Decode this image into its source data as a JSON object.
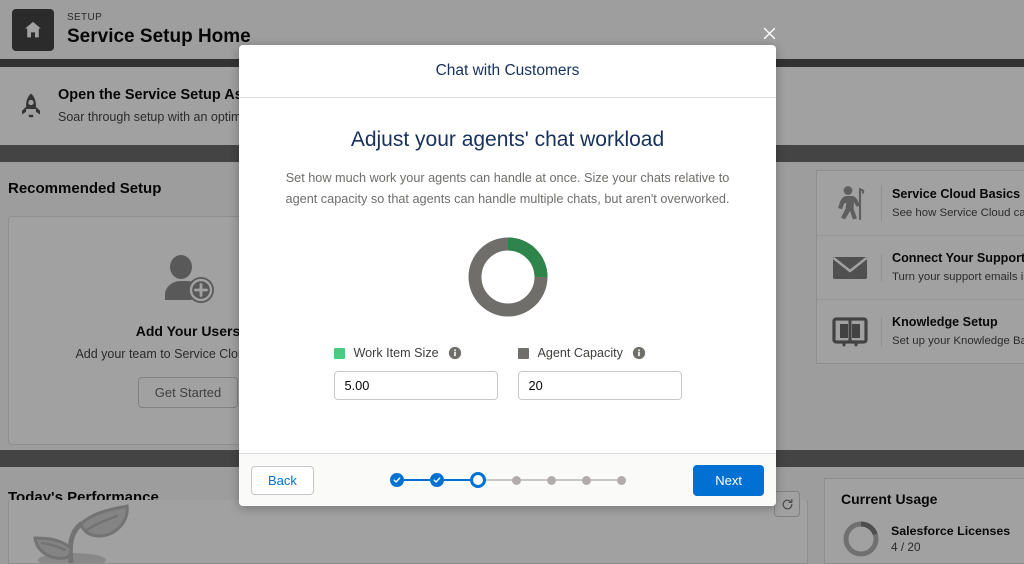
{
  "background": {
    "setup_eyebrow": "SETUP",
    "setup_title": "Service Setup Home",
    "home_icon": "home-icon",
    "assistant": {
      "icon": "rocket-icon",
      "title": "Open the Service Setup Assis",
      "subtitle": "Soar through setup with an optimized, p"
    },
    "recommended_setup_title": "Recommended Setup",
    "todays_performance_title": "Today's Performance",
    "user_card": {
      "icon": "add-user-icon",
      "title": "Add Your Users",
      "description": "Add your team to Service Cloud in t flow.",
      "button_label": "Get Started"
    },
    "refresh_icon": "refresh-icon",
    "sprout_icon": "sprout-icon",
    "rail_items": [
      {
        "icon": "hiker-icon",
        "icon_color": "#4bab5b",
        "title": "Service Cloud Basics",
        "external_icon": "external-link-icon",
        "subtitle": "See how Service Cloud can help you"
      },
      {
        "icon": "envelope-icon",
        "icon_color": "#7b73c8",
        "title": "Connect Your Support Email",
        "subtitle": "Turn your support emails into cases."
      },
      {
        "icon": "book-icon",
        "icon_color": "#c2477c",
        "title": "Knowledge Setup",
        "subtitle": "Set up your Knowledge Base in Servi"
      }
    ],
    "usage": {
      "title": "Current Usage",
      "license_label": "Salesforce Licenses",
      "license_value": "4 / 20",
      "donut_color": "#1589ee",
      "donut_track": "#b0adab",
      "donut_percent": 20
    }
  },
  "modal": {
    "close_icon": "close-icon",
    "header_title": "Chat with Customers",
    "heading": "Adjust your agents' chat workload",
    "description": "Set how much work your agents can handle at once. Size your chats relative to agent capacity so that agents can handle multiple chats, but aren't overworked.",
    "donut": {
      "value_color": "#2e844a",
      "track_color": "#706e6b",
      "percent": 25
    },
    "fields": [
      {
        "legend_label": "Work Item Size",
        "swatch_color": "#4bca81",
        "info_icon": "info-icon",
        "input_name": "work-item-size-input",
        "value": "5.00"
      },
      {
        "legend_label": "Agent Capacity",
        "swatch_color": "#706e6b",
        "info_icon": "info-icon",
        "input_name": "agent-capacity-input",
        "value": "20"
      }
    ],
    "footer": {
      "back_label": "Back",
      "next_label": "Next",
      "progress": {
        "total_steps": 7,
        "completed": 2,
        "active_index": 2,
        "check_icon": "check-icon"
      }
    }
  }
}
